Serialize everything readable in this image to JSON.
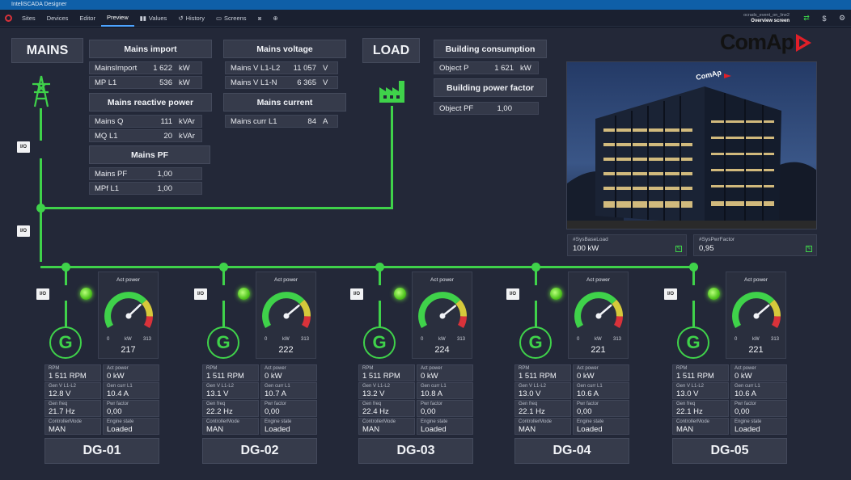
{
  "window_title": "InteliSCADA Designer",
  "toolbar": {
    "items": [
      "Sites",
      "Devices",
      "Editor",
      "Preview"
    ],
    "values": "Values",
    "history": "History",
    "screens": "Screens",
    "project": "ocrads_event_on_line2",
    "screen": "Overview screen"
  },
  "brand": "ComAp",
  "mains": {
    "title": "MAINS",
    "import_title": "Mains import",
    "import_rows": [
      {
        "label": "MainsImport",
        "value": "1 622",
        "unit": "kW"
      },
      {
        "label": "MP L1",
        "value": "536",
        "unit": "kW"
      }
    ],
    "reactive_title": "Mains reactive power",
    "reactive_rows": [
      {
        "label": "Mains Q",
        "value": "111",
        "unit": "kVAr"
      },
      {
        "label": "MQ L1",
        "value": "20",
        "unit": "kVAr"
      }
    ],
    "pf_title": "Mains PF",
    "pf_rows": [
      {
        "label": "Mains PF",
        "value": "1,00",
        "unit": ""
      },
      {
        "label": "MPf L1",
        "value": "1,00",
        "unit": ""
      }
    ],
    "voltage_title": "Mains voltage",
    "voltage_rows": [
      {
        "label": "Mains V L1-L2",
        "value": "11 057",
        "unit": "V"
      },
      {
        "label": "Mains V L1-N",
        "value": "6 365",
        "unit": "V"
      }
    ],
    "current_title": "Mains current",
    "current_rows": [
      {
        "label": "Mains curr L1",
        "value": "84",
        "unit": "A"
      }
    ]
  },
  "load": {
    "title": "LOAD",
    "consumption_title": "Building consumption",
    "consumption_rows": [
      {
        "label": "Object P",
        "value": "1 621",
        "unit": "kW"
      }
    ],
    "pf_title": "Building power factor",
    "pf_rows": [
      {
        "label": "Object PF",
        "value": "1,00",
        "unit": ""
      }
    ]
  },
  "system": [
    {
      "label": "#SysBaseLoad",
      "value": "100 kW"
    },
    {
      "label": "#SysPwrFactor",
      "value": "0,95"
    }
  ],
  "io_label": "I/O",
  "gen_symbol": "G",
  "gauge_title": "Act power",
  "gauge_min": "0",
  "gauge_unit": "kW",
  "gauge_max": "313",
  "generators": [
    {
      "name": "DG-01",
      "power": 217,
      "rpm": "1 511 RPM",
      "act_power": "0 kW",
      "gen_v": "12.8 V",
      "gen_curr": "10.4 A",
      "gen_freq": "21.7 Hz",
      "pwr_factor": "0,00",
      "mode": "MAN",
      "engine_state": "Loaded"
    },
    {
      "name": "DG-02",
      "power": 222,
      "rpm": "1 511 RPM",
      "act_power": "0 kW",
      "gen_v": "13.1 V",
      "gen_curr": "10.7 A",
      "gen_freq": "22.2 Hz",
      "pwr_factor": "0,00",
      "mode": "MAN",
      "engine_state": "Loaded"
    },
    {
      "name": "DG-03",
      "power": 224,
      "rpm": "1 511 RPM",
      "act_power": "0 kW",
      "gen_v": "13.2 V",
      "gen_curr": "10.8 A",
      "gen_freq": "22.4 Hz",
      "pwr_factor": "0,00",
      "mode": "MAN",
      "engine_state": "Loaded"
    },
    {
      "name": "DG-04",
      "power": 221,
      "rpm": "1 511 RPM",
      "act_power": "0 kW",
      "gen_v": "13.0 V",
      "gen_curr": "10.6 A",
      "gen_freq": "22.1 Hz",
      "pwr_factor": "0,00",
      "mode": "MAN",
      "engine_state": "Loaded"
    },
    {
      "name": "DG-05",
      "power": 221,
      "rpm": "1 511 RPM",
      "act_power": "0 kW",
      "gen_v": "13.0 V",
      "gen_curr": "10.6 A",
      "gen_freq": "22.1 Hz",
      "pwr_factor": "0,00",
      "mode": "MAN",
      "engine_state": "Loaded"
    }
  ],
  "cell_labels": {
    "rpm": "RPM",
    "act_power": "Act power",
    "gen_v": "Gen V L1-L2",
    "gen_curr": "Gen curr L1",
    "gen_freq": "Gen freq",
    "pwr_factor": "Pwr factor",
    "mode": "ControllerMode",
    "engine_state": "Engine state"
  },
  "colors": {
    "bus": "#3fd24a",
    "accent": "#e11f28",
    "background": "#232838"
  }
}
